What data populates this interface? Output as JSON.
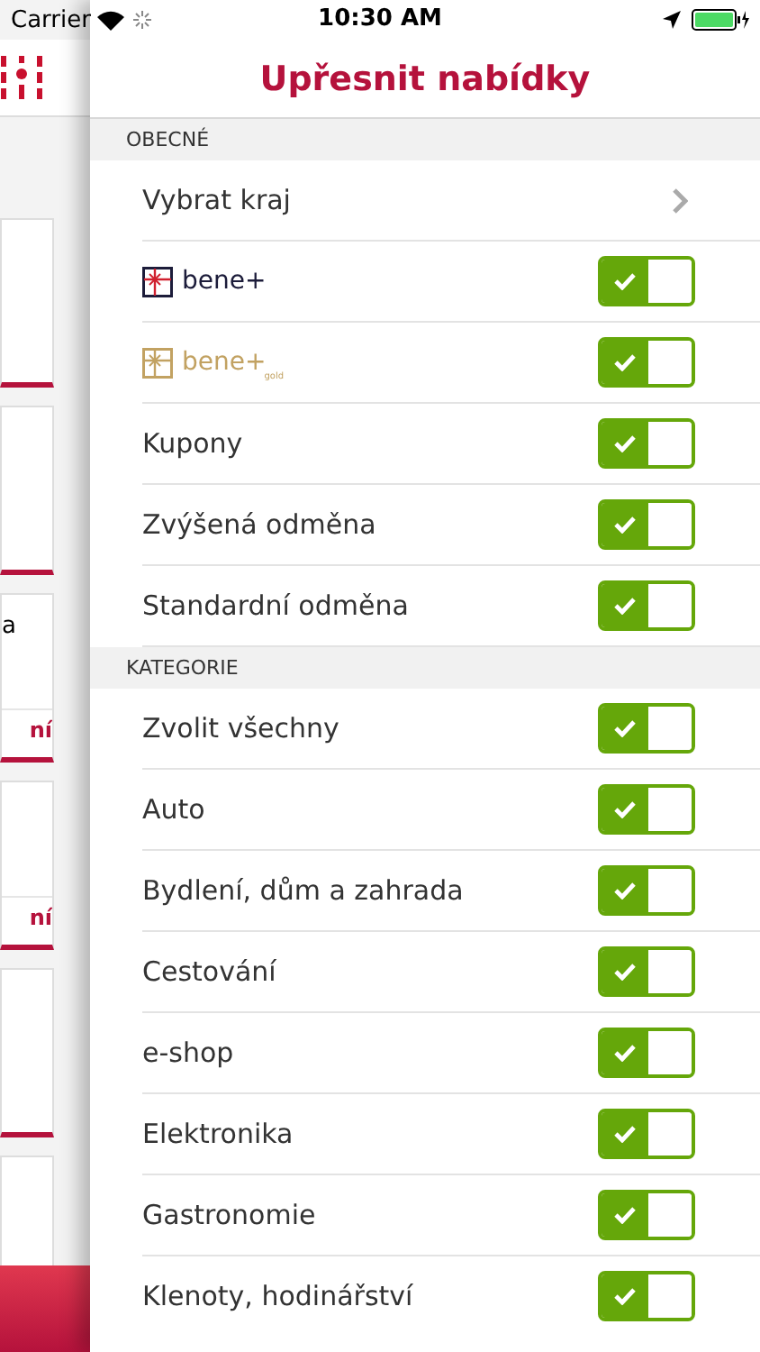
{
  "status_bar": {
    "carrier": "Carrier",
    "time": "10:30 AM"
  },
  "background_list": {
    "cards": [
      {
        "kind": "blank"
      },
      {
        "kind": "blank"
      },
      {
        "kind": "text",
        "text": "a",
        "link": "ní"
      },
      {
        "kind": "text",
        "link": "ní"
      },
      {
        "kind": "blank"
      },
      {
        "kind": "blank"
      }
    ]
  },
  "panel": {
    "title": "Upřesnit nabídky",
    "sections": [
      {
        "header": "OBECNÉ",
        "rows": [
          {
            "kind": "disclosure",
            "label": "Vybrat kraj"
          },
          {
            "kind": "logo",
            "logo_text": "bene+",
            "on": true
          },
          {
            "kind": "gold_logo",
            "logo_text": "bene+",
            "logo_sub": "gold",
            "on": true
          },
          {
            "kind": "toggle",
            "label": "Kupony",
            "on": true
          },
          {
            "kind": "toggle",
            "label": "Zvýšená odměna",
            "on": true
          },
          {
            "kind": "toggle",
            "label": "Standardní odměna",
            "on": true
          }
        ]
      },
      {
        "header": "KATEGORIE",
        "rows": [
          {
            "kind": "toggle",
            "label": "Zvolit všechny",
            "on": true
          },
          {
            "kind": "toggle",
            "label": "Auto",
            "on": true
          },
          {
            "kind": "toggle",
            "label": "Bydlení, dům a zahrada",
            "on": true
          },
          {
            "kind": "toggle",
            "label": "Cestování",
            "on": true
          },
          {
            "kind": "toggle",
            "label": "e-shop",
            "on": true
          },
          {
            "kind": "toggle",
            "label": "Elektronika",
            "on": true
          },
          {
            "kind": "toggle",
            "label": "Gastronomie",
            "on": true
          },
          {
            "kind": "toggle",
            "label": "Klenoty, hodinářství",
            "on": true
          }
        ]
      }
    ]
  }
}
